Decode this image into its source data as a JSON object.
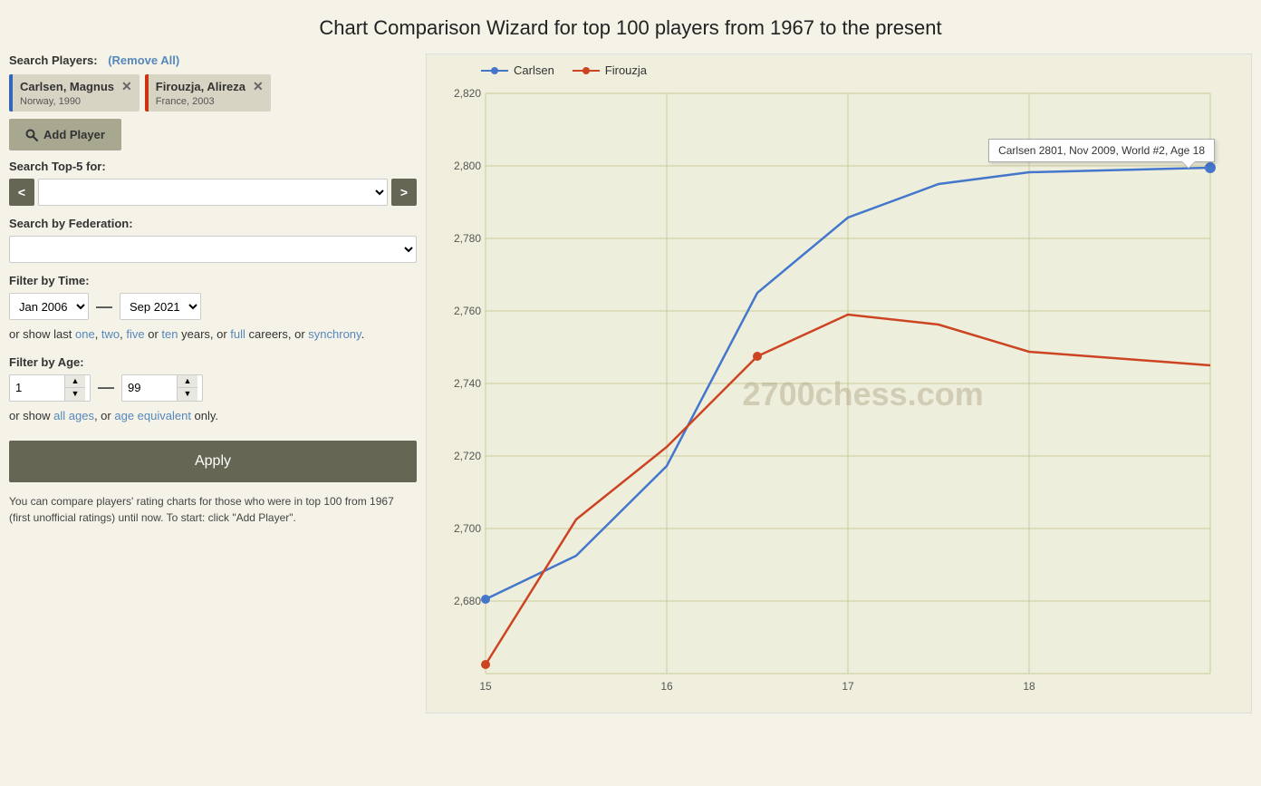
{
  "page": {
    "title": "Chart Comparison Wizard for top 100 players from 1967 to the present"
  },
  "search_players": {
    "label": "Search Players:",
    "remove_all": "(Remove All)"
  },
  "players": [
    {
      "name": "Carlsen, Magnus",
      "country": "Norway, 1990",
      "color": "blue"
    },
    {
      "name": "Firouzja, Alireza",
      "country": "France, 2003",
      "color": "red"
    }
  ],
  "add_player_btn": "Add Player",
  "search_top5": {
    "label": "Search Top-5 for:",
    "prev_label": "<",
    "next_label": ">"
  },
  "search_federation": {
    "label": "Search by Federation:"
  },
  "filter_time": {
    "label": "Filter by Time:",
    "start": "Jan 2006",
    "end": "Sep 2021",
    "dash": "—",
    "links_text": "or show last",
    "one": "one",
    "comma1": ",",
    "two": "two",
    "comma2": ",",
    "five": "five",
    "or1": "or",
    "ten": "ten",
    "years_or": "years, or",
    "full": "full",
    "careers_or": "careers, or",
    "synchrony": "synchrony",
    "dot": "."
  },
  "filter_age": {
    "label": "Filter by Age:",
    "min": "1",
    "max": "99",
    "dash": "—",
    "links_text": "or show",
    "all_ages": "all ages",
    "comma": ",",
    "or": "or",
    "age_equivalent": "age equivalent",
    "only": "only."
  },
  "apply_btn": "Apply",
  "footer_text": "You can compare players' rating charts for those who were in top 100 from 1967 (first unofficial ratings) until now. To start: click \"Add Player\".",
  "chart": {
    "watermark": "2700chess.com",
    "legend": [
      {
        "name": "Carlsen",
        "color": "blue"
      },
      {
        "name": "Firouzja",
        "color": "red"
      }
    ],
    "tooltip": "Carlsen 2801, Nov 2009, World #2, Age 18",
    "y_labels": [
      "2,820",
      "2,800",
      "2,780",
      "2,760",
      "2,740",
      "2,720",
      "2,700",
      "2,680"
    ],
    "x_labels": [
      "15",
      "16",
      "17",
      "18"
    ]
  }
}
